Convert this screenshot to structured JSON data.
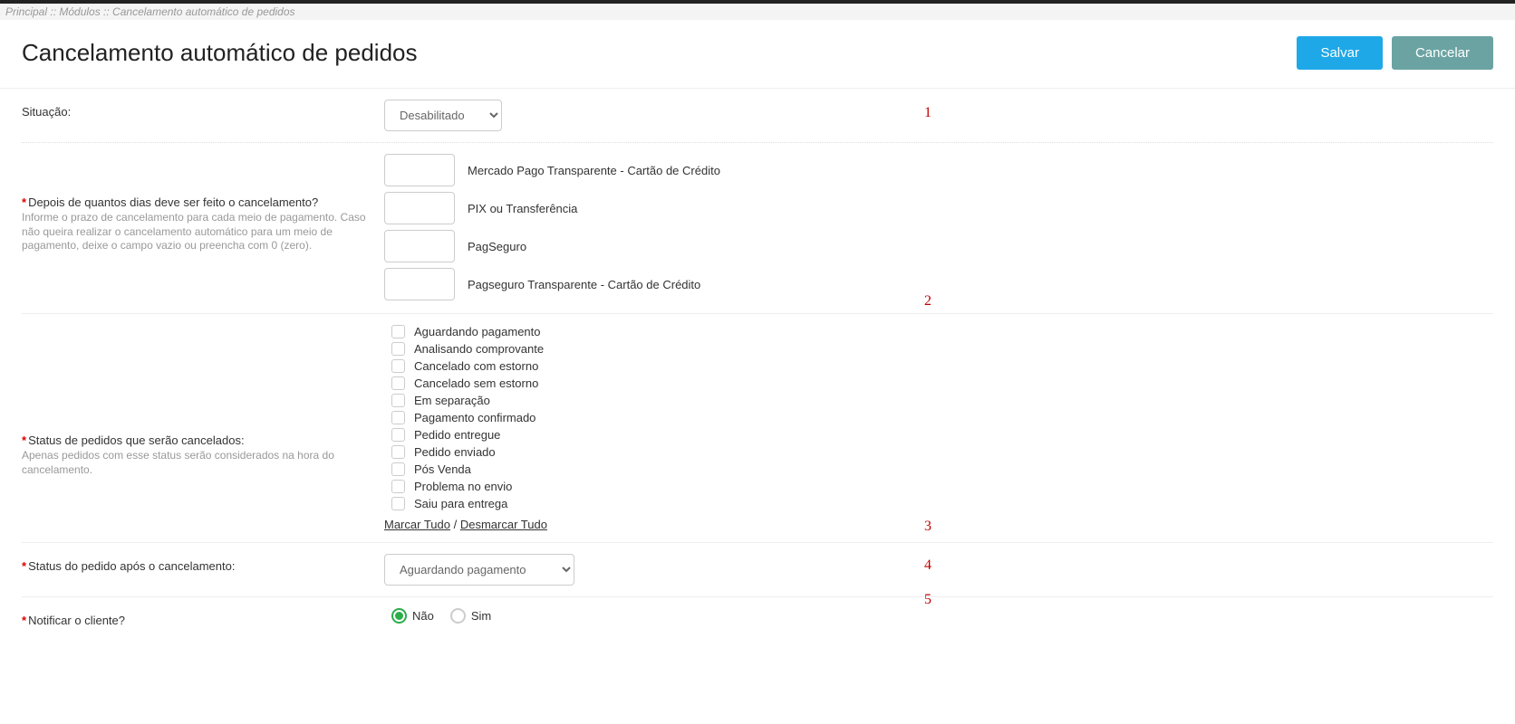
{
  "breadcrumb": "Principal :: Módulos :: Cancelamento automático de pedidos",
  "title": "Cancelamento automático de pedidos",
  "buttons": {
    "save": "Salvar",
    "cancel": "Cancelar"
  },
  "situation": {
    "label": "Situação:",
    "value": "Desabilitado"
  },
  "days_field": {
    "label": "Depois de quantos dias deve ser feito o cancelamento?",
    "help": "Informe o prazo de cancelamento para cada meio de pagamento. Caso não queira realizar o cancelamento automático para um meio de pagamento, deixe o campo vazio ou preencha com 0 (zero).",
    "payments": [
      "Mercado Pago Transparente - Cartão de Crédito",
      "PIX ou Transferência",
      "PagSeguro",
      "Pagseguro Transparente - Cartão de Crédito"
    ]
  },
  "status_cancel": {
    "label": "Status de pedidos que serão cancelados:",
    "help": "Apenas pedidos com esse status serão considerados na hora do cancelamento.",
    "options": [
      "Aguardando pagamento",
      "Analisando comprovante",
      "Cancelado com estorno",
      "Cancelado sem estorno",
      "Em separação",
      "Pagamento confirmado",
      "Pedido entregue",
      "Pedido enviado",
      "Pós Venda",
      "Problema no envio",
      "Saiu para entrega"
    ],
    "mark_all": "Marcar Tudo",
    "sep": " / ",
    "unmark_all": "Desmarcar Tudo"
  },
  "status_after": {
    "label": "Status do pedido após o cancelamento:",
    "value": "Aguardando pagamento"
  },
  "notify": {
    "label": "Notificar o cliente?",
    "no": "Não",
    "yes": "Sim",
    "selected": "no"
  },
  "annot": {
    "a1": "1",
    "a2": "2",
    "a3": "3",
    "a4": "4",
    "a5": "5"
  }
}
